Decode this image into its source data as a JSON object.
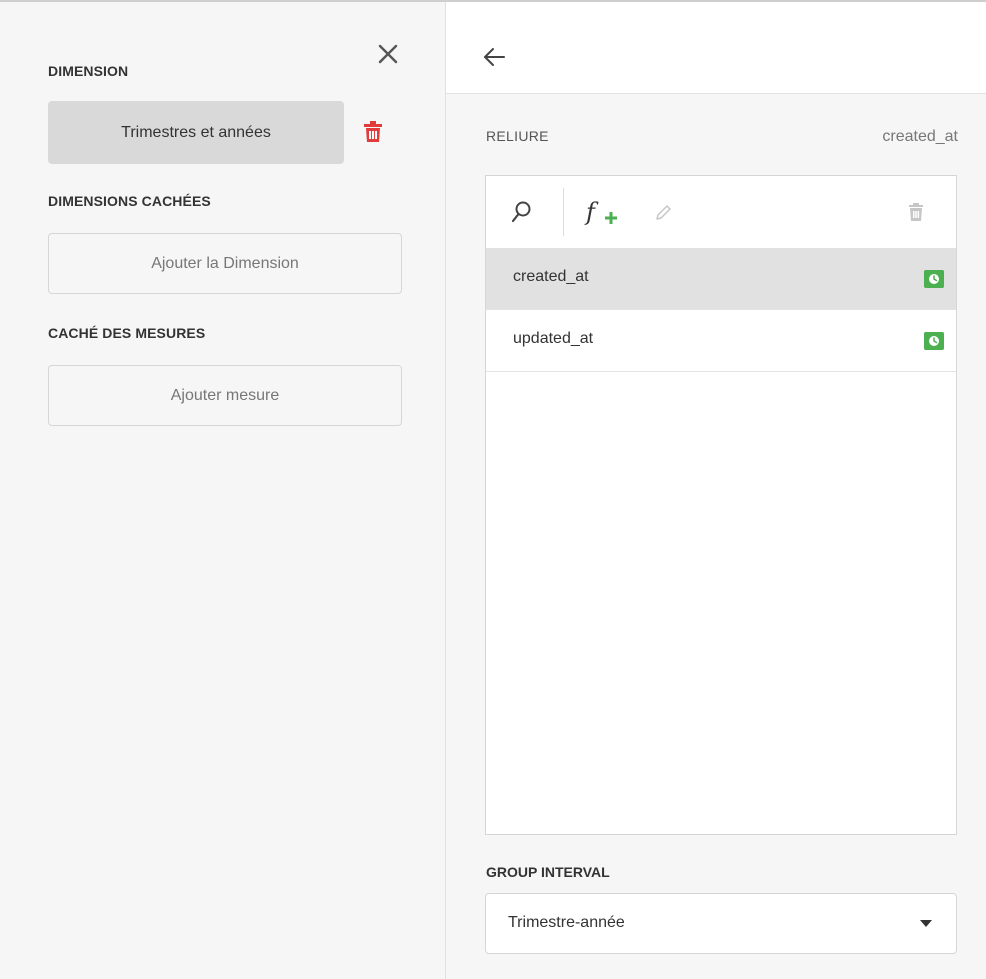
{
  "left": {
    "dimension_label": "DIMENSION",
    "dimension_value": "Trimestres et années",
    "hidden_dimensions_label": "DIMENSIONS CACHÉES",
    "add_dimension_button": "Ajouter la Dimension",
    "hidden_measures_label": "CACHÉ DES MESURES",
    "add_measure_button": "Ajouter mesure"
  },
  "right": {
    "binding_label": "RELIURE",
    "binding_value": "created_at",
    "fields": [
      {
        "name": "created_at",
        "selected": true,
        "type_icon": "clock-icon"
      },
      {
        "name": "updated_at",
        "selected": false,
        "type_icon": "clock-icon"
      }
    ],
    "group_interval_label": "GROUP INTERVAL",
    "group_interval_value": "Trimestre-année"
  },
  "icons": [
    "close-icon",
    "trash-icon",
    "back-arrow-icon",
    "search-icon",
    "add-function-icon",
    "edit-icon",
    "clock-icon",
    "caret-down-icon"
  ],
  "colors": {
    "accent_red": "#e23b3b",
    "accent_green": "#4caf50",
    "selected_row": "#e1e1e1",
    "panel_bg": "#f6f6f6"
  }
}
